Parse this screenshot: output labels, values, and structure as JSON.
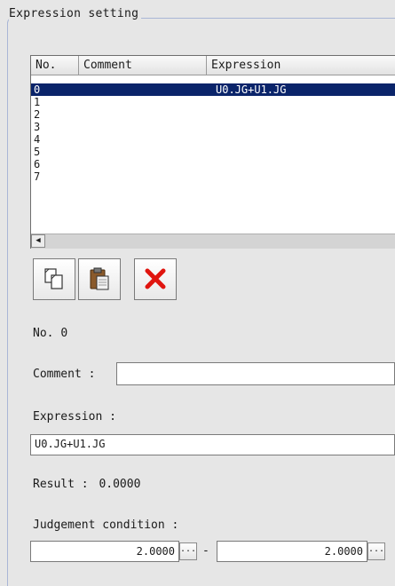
{
  "group": {
    "title": "Expression setting"
  },
  "list": {
    "columns": [
      "No.",
      "Comment",
      "Expression"
    ],
    "rows": [
      {
        "no": "0",
        "comment": "",
        "expression": "U0.JG+U1.JG",
        "selected": true
      },
      {
        "no": "1",
        "comment": "",
        "expression": ""
      },
      {
        "no": "2",
        "comment": "",
        "expression": ""
      },
      {
        "no": "3",
        "comment": "",
        "expression": ""
      },
      {
        "no": "4",
        "comment": "",
        "expression": ""
      },
      {
        "no": "5",
        "comment": "",
        "expression": ""
      },
      {
        "no": "6",
        "comment": "",
        "expression": ""
      },
      {
        "no": "7",
        "comment": "",
        "expression": ""
      }
    ],
    "scroll_left_glyph": "◀"
  },
  "toolbar": {
    "copy_icon": "copy-icon",
    "paste_icon": "paste-icon",
    "delete_icon": "delete-icon",
    "delete_color": "#e0150f"
  },
  "detail": {
    "no_label": "No.",
    "no_value": "0",
    "comment_label": "Comment :",
    "comment_value": "",
    "expression_label": "Expression :",
    "expression_value": "U0.JG+U1.JG",
    "result_label": "Result :",
    "result_value": "0.0000",
    "judgement_label": "Judgement condition :",
    "judgement_lower": "2.0000",
    "judgement_upper": "2.0000",
    "range_separator": "-",
    "dots_label": "..."
  },
  "colors": {
    "selection": "#0a246a",
    "background": "#e6e6e6",
    "frame": "#a9b6d6"
  }
}
